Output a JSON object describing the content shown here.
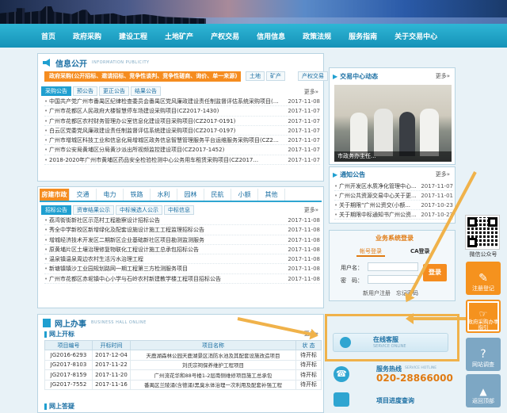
{
  "nav": [
    "首页",
    "政府采购",
    "建设工程",
    "土地矿产",
    "产权交易",
    "信用信息",
    "政策法规",
    "服务指南",
    "关于交易中心"
  ],
  "info": {
    "title": "信息公开",
    "subtitle": "INFORMATION PUBLICITY",
    "gov_bar": "政府采购(公开招标、邀请招标、竞争性谈判、竞争性磋商、询价、单一来源)",
    "side_tabs": [
      "土地",
      "矿产",
      "产权交易"
    ],
    "sub_tabs": [
      "采购公告",
      "预公告",
      "更正公告",
      "结果公告"
    ],
    "more": "更多»",
    "items": [
      {
        "t": "中国共产党广州市番禺区纪律检查委员会番禺区党风廉政建设责任制监督评估系统采购项目(CD201...",
        "d": "2017-11-08"
      },
      {
        "t": "广州市花都区人民政府大楼智慧停车场建设采购项目(CZ2017-1430)",
        "d": "2017-11-07"
      },
      {
        "t": "广州市花都区农村财务管理办公室信息化建设项目采购项目(CZ2017-0191)",
        "d": "2017-11-07"
      },
      {
        "t": "白云区党委党风廉政建设责任制监督评估系统建设采购项目(CZ2017-0197)",
        "d": "2017-11-07"
      },
      {
        "t": "广州市增城区科技工业和信息化局增城区政务信息智慧管理服务平台运维服务采购项目(CZ2017-14...",
        "d": "2017-11-07"
      },
      {
        "t": "广州市公安局黄埔区分局黄沙派出所视频监控建设项目(CZ2017-1452)",
        "d": "2017-11-07"
      },
      {
        "t": "2018-2020年广州市黄埔区药品安全检验检测中心公务用车租赁采购项目(CZ2017...",
        "d": "2017-11-07"
      }
    ]
  },
  "construction": {
    "cats": [
      "房建市政",
      "交通",
      "电力",
      "铁路",
      "水利",
      "园林",
      "民航",
      "小额",
      "其他"
    ],
    "sub_tabs": [
      "招标公告",
      "资审结果公示",
      "中标候选人公示",
      "中标信息"
    ],
    "more": "更多»",
    "items": [
      {
        "t": "荔湾街街新社区示范村工程勘察设计招标公告",
        "d": "2017-11-08"
      },
      {
        "t": "秀全中学新校区新增绿化及配套设施设计施工工程监理招标公告",
        "d": "2017-11-08"
      },
      {
        "t": "增城经济技术开发区二期新区企业基础新社区项目勘测监测服务",
        "d": "2017-11-08"
      },
      {
        "t": "原黄埔片区土壤治理修复物联化工程设计施工总承包招标公告",
        "d": "2017-11-08"
      },
      {
        "t": "温泉镇温泉周边农村生活污水治理工程",
        "d": "2017-11-08"
      },
      {
        "t": "新塘镇镇沙工业园规划路网一期工程第三方检测服务项目",
        "d": "2017-11-08"
      },
      {
        "t": "广州市花都区赤坭镇中心小学与石岭农村新建教学楼工程项目招标公告",
        "d": "2017-11-08"
      }
    ]
  },
  "online": {
    "title": "网上办事",
    "subtitle": "BUSINESS HALL ONLINE",
    "section": "网上开标",
    "more": "更多»",
    "headers": [
      "项目编号",
      "开标时间",
      "项目名称",
      "状 态"
    ],
    "rows": [
      {
        "no": "JG2016-6293",
        "time": "2017-12-04",
        "name": "天鹿湖森林公园天鹿湖景区消防水池及其配套设施改造项目",
        "status": "待开标"
      },
      {
        "no": "JG2017-8103",
        "time": "2017-11-22",
        "name": "刘氏宗祠保养维护工程项目",
        "status": "待开标"
      },
      {
        "no": "JG2017-8159",
        "time": "2017-11-20",
        "name": "广州流花华和88号楼1-2层南侧维修项目施工总承包",
        "status": "待开标"
      },
      {
        "no": "JG2017-7552",
        "time": "2017-11-16",
        "name": "番禺区兰陵涌(含德涌)黑臭水体治理一次利用及配套补强工程",
        "status": "待开标"
      }
    ],
    "bottom_label": "网上答疑"
  },
  "center_news": {
    "title": "交易中心动态",
    "more": "更多»",
    "caption": "市政务办主任..."
  },
  "notice": {
    "title": "通知公告",
    "more": "更多»",
    "items": [
      {
        "t": "广州开发区水质净化管理中心...",
        "d": "2017-11-07"
      },
      {
        "t": "广州公共资源交易中心关于更...",
        "d": "2017-11-01"
      },
      {
        "t": "关于期限“广州公资交(小额...",
        "d": "2017-10-23"
      },
      {
        "t": "关于期限中标通知书广州公资...",
        "d": "2017-10-23"
      }
    ]
  },
  "login": {
    "title": "业务系统登录",
    "tabs": [
      "帐号登录",
      "CA登录"
    ],
    "user_label": "用户名：",
    "pass_label": "密　码：",
    "submit": "登录",
    "links": [
      "新用户注册",
      "忘记密码"
    ]
  },
  "service": {
    "title": "在线客服",
    "subtitle": "SERVICE ONLINE"
  },
  "hotline": {
    "title": "服务热线",
    "subtitle": "SERVICE HOTLINE",
    "number": "020-28866000"
  },
  "progress": {
    "title": "项目进度查询"
  },
  "right_rail": {
    "qr_label": "微信公众号",
    "buttons": [
      "注册登记",
      "政府采购办事指引",
      "网站调查",
      "返回顶部"
    ]
  }
}
